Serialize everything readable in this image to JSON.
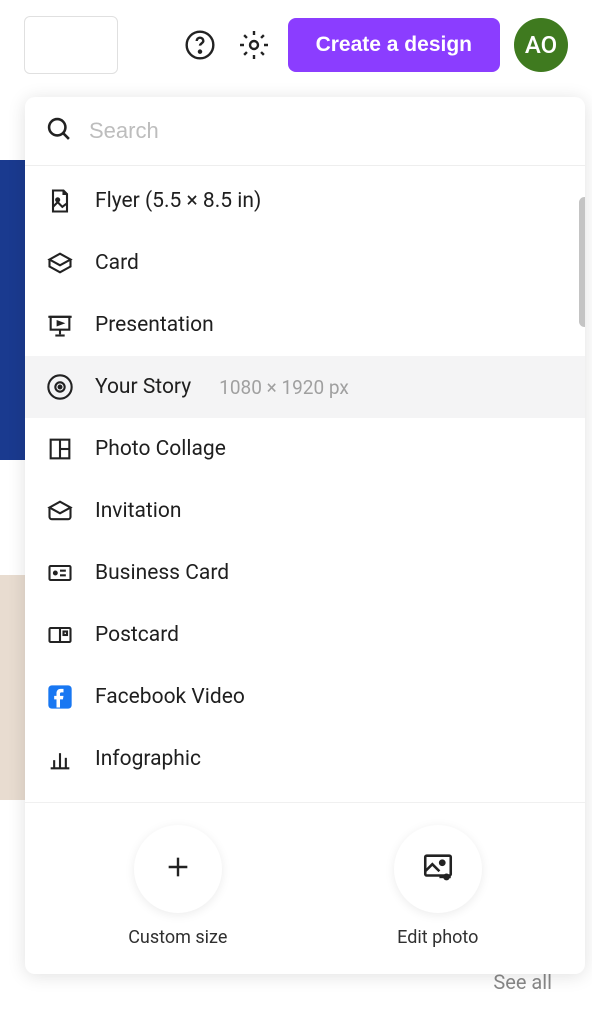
{
  "header": {
    "create_label": "Create a design",
    "avatar_initials": "AO"
  },
  "dropdown": {
    "search_placeholder": "Search",
    "items": [
      {
        "icon": "flyer",
        "label": "Flyer (5.5 × 8.5 in)",
        "dims": "",
        "highlight": false
      },
      {
        "icon": "card",
        "label": "Card",
        "dims": "",
        "highlight": false
      },
      {
        "icon": "presentation",
        "label": "Presentation",
        "dims": "",
        "highlight": false
      },
      {
        "icon": "story",
        "label": "Your Story",
        "dims": "1080 × 1920 px",
        "highlight": true
      },
      {
        "icon": "collage",
        "label": "Photo Collage",
        "dims": "",
        "highlight": false
      },
      {
        "icon": "invitation",
        "label": "Invitation",
        "dims": "",
        "highlight": false
      },
      {
        "icon": "bizcard",
        "label": "Business Card",
        "dims": "",
        "highlight": false
      },
      {
        "icon": "postcard",
        "label": "Postcard",
        "dims": "",
        "highlight": false
      },
      {
        "icon": "fbvideo",
        "label": "Facebook Video",
        "dims": "",
        "highlight": false
      },
      {
        "icon": "infographic",
        "label": "Infographic",
        "dims": "",
        "highlight": false
      }
    ],
    "actions": {
      "custom_size": "Custom size",
      "edit_photo": "Edit photo"
    }
  },
  "behind": {
    "see_all": "See all"
  }
}
